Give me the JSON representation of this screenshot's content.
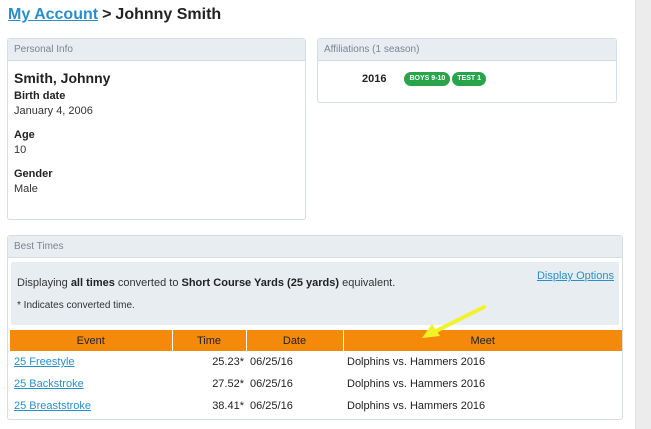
{
  "header": {
    "account_link": "My Account",
    "separator": ">",
    "athlete_name": "Johnny Smith"
  },
  "personal_info": {
    "title": "Personal Info",
    "name": "Smith, Johnny",
    "birth_label": "Birth date",
    "birth_value": "January 4, 2006",
    "age_label": "Age",
    "age_value": "10",
    "gender_label": "Gender",
    "gender_value": "Male"
  },
  "affiliations": {
    "title": "Affiliations (1 season)",
    "year": "2016",
    "badges": [
      "BOYS 9-10",
      "TEST 1"
    ],
    "badge_color": "#2aa44a"
  },
  "best_times": {
    "title": "Best Times",
    "info_prefix": "Displaying ",
    "info_bold1": "all times",
    "info_mid": " converted to ",
    "info_bold2": "Short Course Yards (25 yards)",
    "info_suffix": " equivalent.",
    "note": "* Indicates converted time.",
    "display_options": "Display Options",
    "columns": [
      "Event",
      "Time",
      "Date",
      "Meet"
    ],
    "rows": [
      {
        "event": "25 Freestyle",
        "time": "25.23*",
        "date": "06/25/16",
        "meet": "Dolphins vs. Hammers 2016"
      },
      {
        "event": "25 Backstroke",
        "time": "27.52*",
        "date": "06/25/16",
        "meet": "Dolphins vs. Hammers 2016"
      },
      {
        "event": "25 Breaststroke",
        "time": "38.41*",
        "date": "06/25/16",
        "meet": "Dolphins vs. Hammers 2016"
      }
    ],
    "header_color": "#f5890a"
  },
  "colors": {
    "link": "#2a8fc9",
    "annotation_arrow": "#f2f22a"
  }
}
